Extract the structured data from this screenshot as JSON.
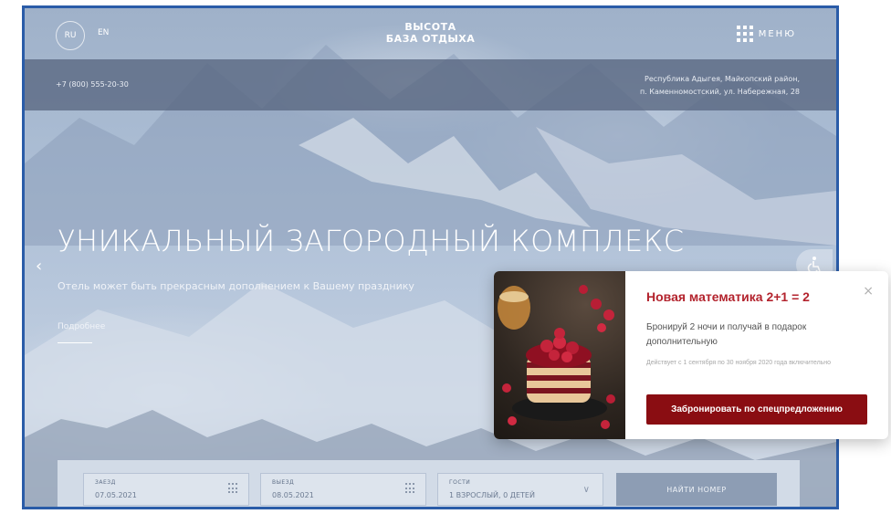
{
  "header": {
    "lang_ru": "RU",
    "lang_en": "EN",
    "brand_line1": "ВЫСОТА",
    "brand_line2": "БАЗА ОТДЫХА",
    "menu_label": "МЕНЮ",
    "menu_icon": "grid-icon"
  },
  "info": {
    "phone": "+7 (800) 555-20-30",
    "address_line1": "Республика Адыгея, Майкопский район,",
    "address_line2": "п. Каменномостский, ул. Набережная, 28"
  },
  "hero": {
    "title": "УНИКАЛЬНЫЙ ЗАГОРОДНЫЙ КОМПЛЕКС",
    "subtitle": "Отель может быть прекрасным дополнением к Вашему празднику",
    "more_link": "Подробнее",
    "prev_arrow": "‹"
  },
  "booking": {
    "checkin_label": "ЗАЕЗД",
    "checkin_value": "07.05.2021",
    "checkout_label": "ВЫЕЗД",
    "checkout_value": "08.05.2021",
    "guests_label": "ГОСТИ",
    "guests_value": "1 ВЗРОСЛЫЙ, 0 ДЕТЕЙ",
    "find_button": "НАЙТИ НОМЕР"
  },
  "popup": {
    "title": "Новая математика 2+1 = 2",
    "text": "Бронируй 2 ночи и получай в подарок дополнительную",
    "note": "Действует с 1 сентября по 30 ноября 2020 года включительно",
    "button": "Забронировать по спецпредложению",
    "close": "×"
  },
  "colors": {
    "frame_border": "#2a5ca8",
    "popup_accent": "#b3232d",
    "popup_button": "#8a0d12"
  }
}
